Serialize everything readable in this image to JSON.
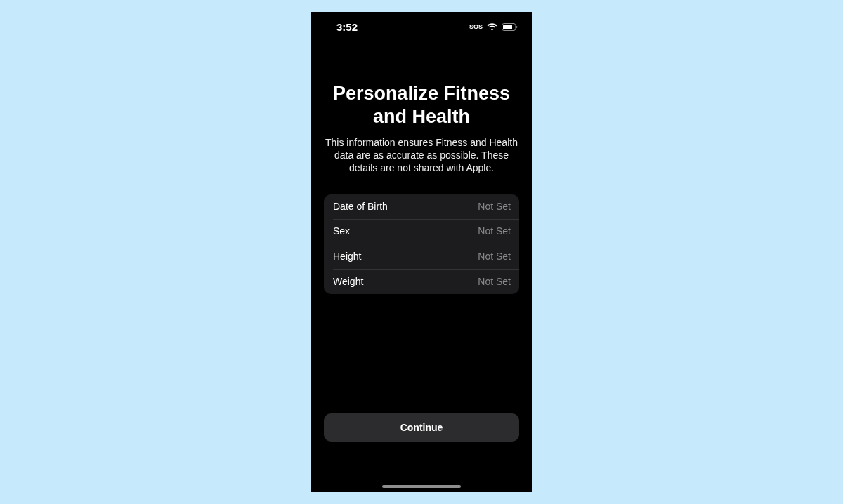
{
  "status_bar": {
    "time": "3:52",
    "carrier": "SOS"
  },
  "title": "Personalize Fitness and Health",
  "description": "This information ensures Fitness and Health data are as accurate as possible. These details are not shared with Apple.",
  "fields": [
    {
      "label": "Date of Birth",
      "value": "Not Set"
    },
    {
      "label": "Sex",
      "value": "Not Set"
    },
    {
      "label": "Height",
      "value": "Not Set"
    },
    {
      "label": "Weight",
      "value": "Not Set"
    }
  ],
  "buttons": [
    {
      "label": "Continue"
    }
  ]
}
